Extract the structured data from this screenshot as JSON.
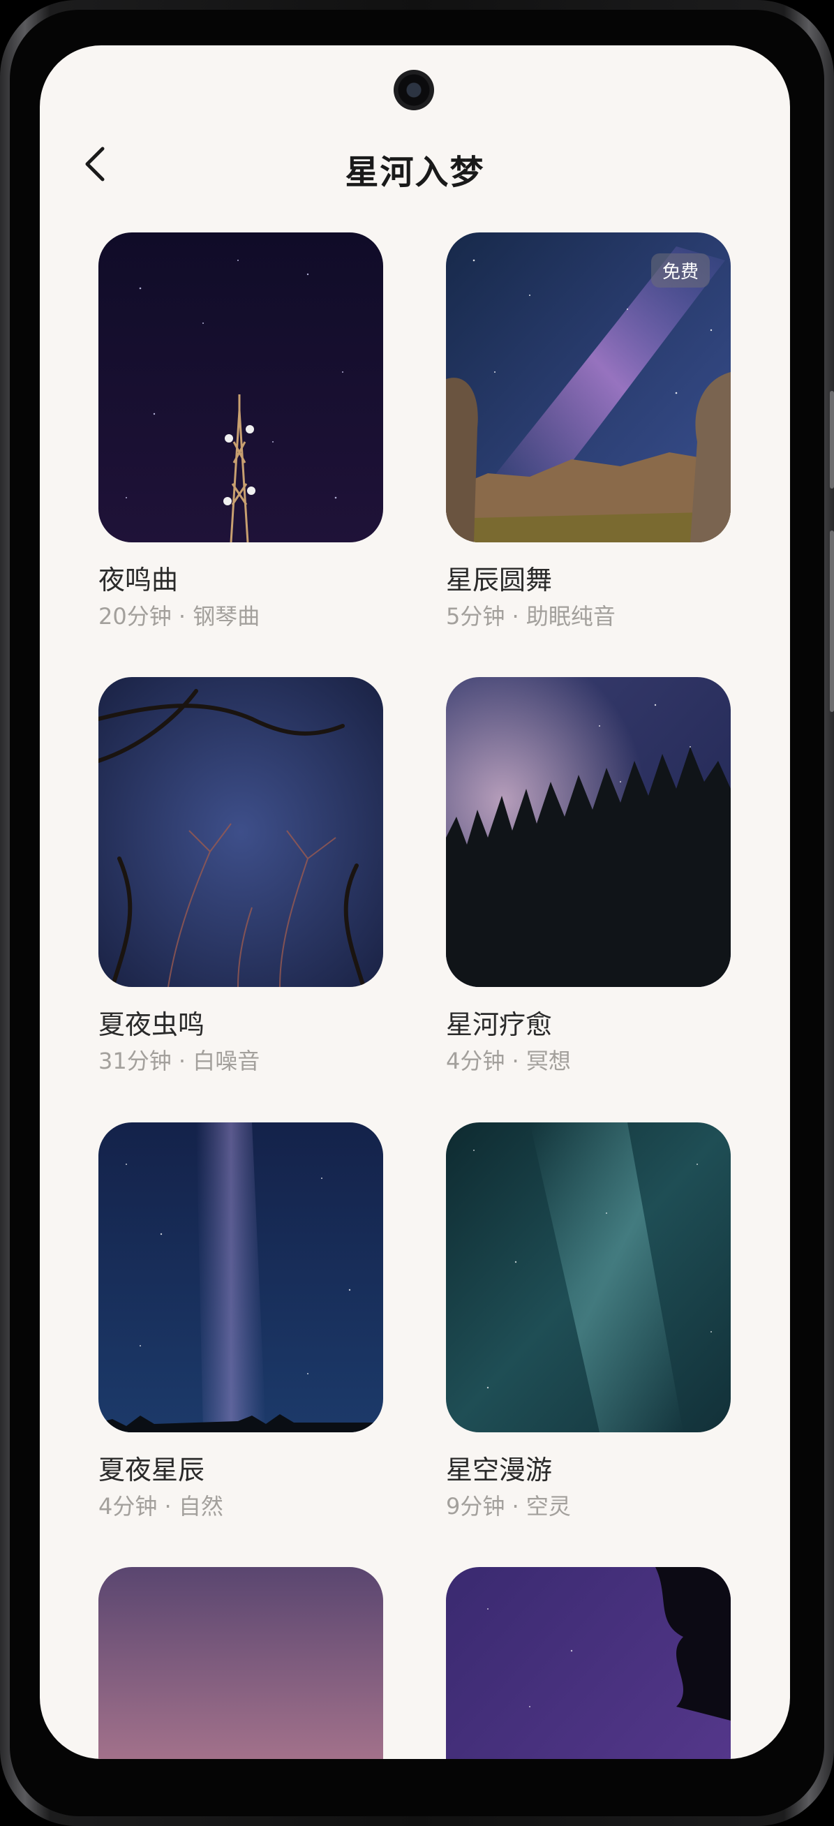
{
  "header": {
    "title": "星河入梦",
    "back_icon": "chevron-left-icon"
  },
  "items": [
    {
      "title": "夜鸣曲",
      "meta": "20分钟 · 钢琴曲"
    },
    {
      "title": "星辰圆舞",
      "meta": "5分钟 · 助眠纯音",
      "badge": "免费"
    },
    {
      "title": "夏夜虫鸣",
      "meta": "31分钟 · 白噪音"
    },
    {
      "title": "星河疗愈",
      "meta": "4分钟 · 冥想"
    },
    {
      "title": "夏夜星辰",
      "meta": "4分钟 · 自然"
    },
    {
      "title": "星空漫游",
      "meta": "9分钟 · 空灵"
    }
  ],
  "colors": {
    "background": "#f9f6f3",
    "title": "#1a1a1a",
    "subtitle": "#a3a09c"
  }
}
